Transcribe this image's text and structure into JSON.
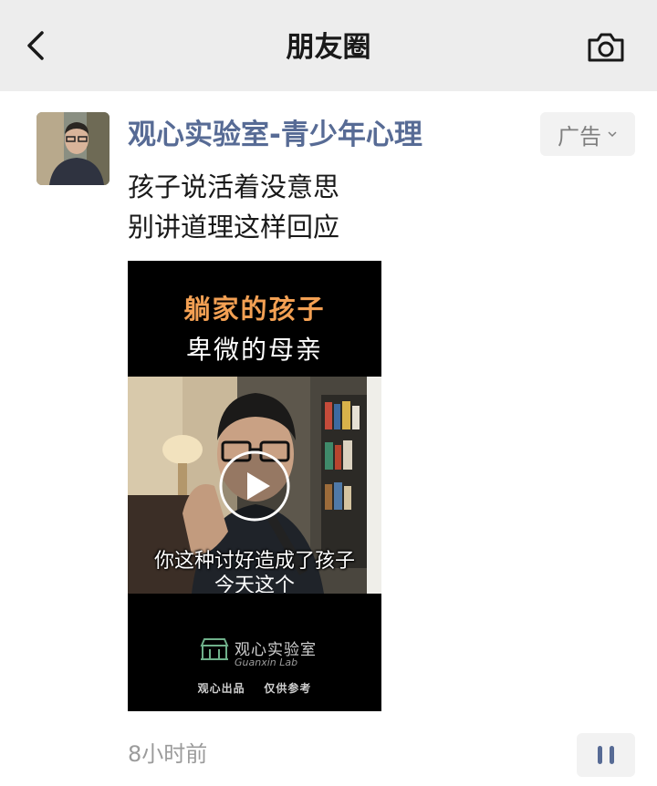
{
  "nav": {
    "title": "朋友圈",
    "back_icon": "chevron-left-icon",
    "camera_icon": "camera-icon"
  },
  "post": {
    "author": "观心实验室-青少年心理",
    "ad_label": "广告",
    "text_lines": [
      "孩子说活着没意思",
      "别讲道理这样回应"
    ],
    "timestamp": "8小时前",
    "video": {
      "headline_1": "躺家的孩子",
      "headline_2": "卑微的母亲",
      "subtitle_1": "你这种讨好造成了孩子",
      "subtitle_2": "今天这个",
      "brand_cn": "观心实验室",
      "brand_en": "Guanxin Lab",
      "credit": "观心出品    仅供参考",
      "headline_color": "#f3a053",
      "play_icon": "play-icon"
    },
    "more_icon": "more-dots-icon"
  },
  "colors": {
    "nav_bg": "#ededed",
    "author_link": "#576b95",
    "body_text": "#191919",
    "muted": "#9b9b9b"
  }
}
